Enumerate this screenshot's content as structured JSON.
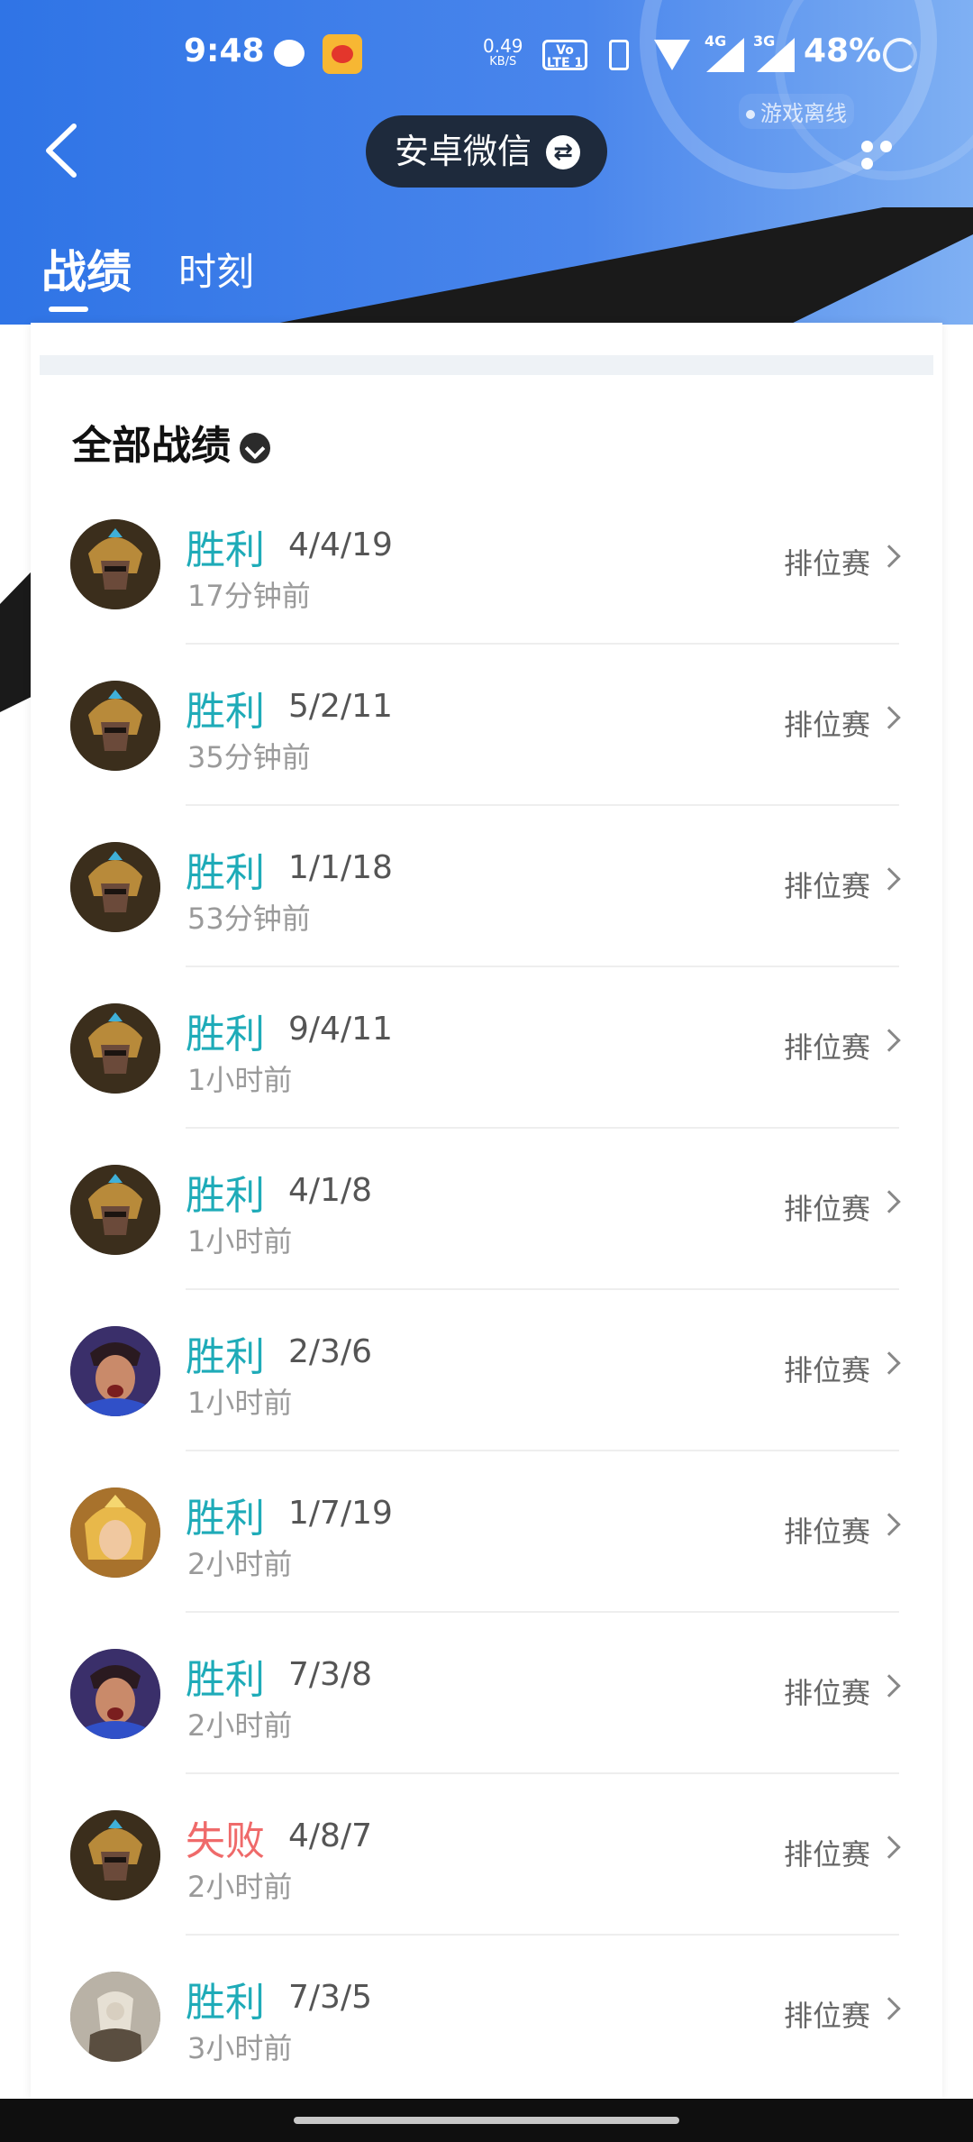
{
  "status_bar": {
    "time": "9:48",
    "speed_value": "0.49",
    "speed_unit": "KB/S",
    "volte": "Vo LTE 1",
    "net1": "4G",
    "net2": "3G",
    "battery": "48%"
  },
  "game_status": "游戏离线",
  "nav": {
    "account_label": "安卓微信",
    "swap_symbol": "⇄"
  },
  "tabs": [
    {
      "label": "战绩",
      "active": true
    },
    {
      "label": "时刻",
      "active": false
    }
  ],
  "filter_label": "全部战绩",
  "colors": {
    "win": "#1eabb8",
    "loss": "#ef6a6a",
    "header_blue": "#2f74e6"
  },
  "matches": [
    {
      "result": "胜利",
      "kda": "4/4/19",
      "time_ago": "17分钟前",
      "mode": "排位赛",
      "hero": "armored-warrior",
      "outcome": "win"
    },
    {
      "result": "胜利",
      "kda": "5/2/11",
      "time_ago": "35分钟前",
      "mode": "排位赛",
      "hero": "armored-warrior",
      "outcome": "win"
    },
    {
      "result": "胜利",
      "kda": "1/1/18",
      "time_ago": "53分钟前",
      "mode": "排位赛",
      "hero": "armored-warrior",
      "outcome": "win"
    },
    {
      "result": "胜利",
      "kda": "9/4/11",
      "time_ago": "1小时前",
      "mode": "排位赛",
      "hero": "armored-warrior",
      "outcome": "win"
    },
    {
      "result": "胜利",
      "kda": "4/1/8",
      "time_ago": "1小时前",
      "mode": "排位赛",
      "hero": "armored-warrior",
      "outcome": "win"
    },
    {
      "result": "胜利",
      "kda": "2/3/6",
      "time_ago": "1小时前",
      "mode": "排位赛",
      "hero": "shouting-warrior",
      "outcome": "win"
    },
    {
      "result": "胜利",
      "kda": "1/7/19",
      "time_ago": "2小时前",
      "mode": "排位赛",
      "hero": "golden-heroine",
      "outcome": "win"
    },
    {
      "result": "胜利",
      "kda": "7/3/8",
      "time_ago": "2小时前",
      "mode": "排位赛",
      "hero": "shouting-warrior",
      "outcome": "win"
    },
    {
      "result": "失败",
      "kda": "4/8/7",
      "time_ago": "2小时前",
      "mode": "排位赛",
      "hero": "armored-warrior",
      "outcome": "loss"
    },
    {
      "result": "胜利",
      "kda": "7/3/5",
      "time_ago": "3小时前",
      "mode": "排位赛",
      "hero": "silver-knight",
      "outcome": "win"
    }
  ]
}
